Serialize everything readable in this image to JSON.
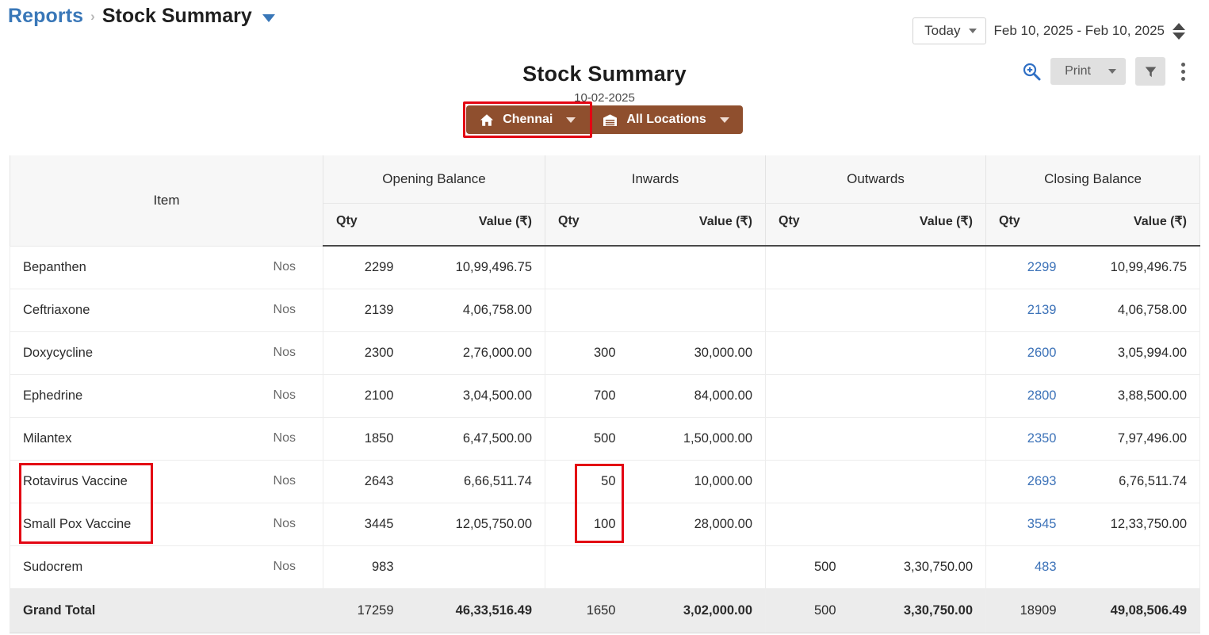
{
  "breadcrumb": {
    "root": "Reports",
    "separator": "›",
    "current": "Stock Summary"
  },
  "header": {
    "today_label": "Today",
    "date_range": "Feb 10, 2025 - Feb 10, 2025",
    "print_label": "Print"
  },
  "report": {
    "title": "Stock Summary",
    "date": "10-02-2025",
    "location_primary": "Chennai",
    "location_secondary": "All Locations",
    "accent_brown": "#8f4f2e",
    "link_blue": "#3c72b8",
    "annotation_red": "#e30613"
  },
  "table": {
    "item_header": "Item",
    "groups": [
      "Opening Balance",
      "Inwards",
      "Outwards",
      "Closing Balance"
    ],
    "sub_headers": [
      "Qty",
      "Value (₹)"
    ],
    "uom": "Nos",
    "rows": [
      {
        "item": "Bepanthen",
        "uom": "Nos",
        "ob_qty": "2299",
        "ob_val": "10,99,496.75",
        "in_qty": "",
        "in_val": "",
        "out_qty": "",
        "out_val": "",
        "cb_qty": "2299",
        "cb_val": "10,99,496.75"
      },
      {
        "item": "Ceftriaxone",
        "uom": "Nos",
        "ob_qty": "2139",
        "ob_val": "4,06,758.00",
        "in_qty": "",
        "in_val": "",
        "out_qty": "",
        "out_val": "",
        "cb_qty": "2139",
        "cb_val": "4,06,758.00"
      },
      {
        "item": "Doxycycline",
        "uom": "Nos",
        "ob_qty": "2300",
        "ob_val": "2,76,000.00",
        "in_qty": "300",
        "in_val": "30,000.00",
        "out_qty": "",
        "out_val": "",
        "cb_qty": "2600",
        "cb_val": "3,05,994.00"
      },
      {
        "item": "Ephedrine",
        "uom": "Nos",
        "ob_qty": "2100",
        "ob_val": "3,04,500.00",
        "in_qty": "700",
        "in_val": "84,000.00",
        "out_qty": "",
        "out_val": "",
        "cb_qty": "2800",
        "cb_val": "3,88,500.00"
      },
      {
        "item": "Milantex",
        "uom": "Nos",
        "ob_qty": "1850",
        "ob_val": "6,47,500.00",
        "in_qty": "500",
        "in_val": "1,50,000.00",
        "out_qty": "",
        "out_val": "",
        "cb_qty": "2350",
        "cb_val": "7,97,496.00"
      },
      {
        "item": "Rotavirus Vaccine",
        "uom": "Nos",
        "ob_qty": "2643",
        "ob_val": "6,66,511.74",
        "in_qty": "50",
        "in_val": "10,000.00",
        "out_qty": "",
        "out_val": "",
        "cb_qty": "2693",
        "cb_val": "6,76,511.74"
      },
      {
        "item": "Small Pox Vaccine",
        "uom": "Nos",
        "ob_qty": "3445",
        "ob_val": "12,05,750.00",
        "in_qty": "100",
        "in_val": "28,000.00",
        "out_qty": "",
        "out_val": "",
        "cb_qty": "3545",
        "cb_val": "12,33,750.00"
      },
      {
        "item": "Sudocrem",
        "uom": "Nos",
        "ob_qty": "983",
        "ob_val": "",
        "in_qty": "",
        "in_val": "",
        "out_qty": "500",
        "out_val": "3,30,750.00",
        "cb_qty": "483",
        "cb_val": ""
      }
    ],
    "grand_total": {
      "item": "Grand Total",
      "ob_qty": "17259",
      "ob_val": "46,33,516.49",
      "in_qty": "1650",
      "in_val": "3,02,000.00",
      "out_qty": "500",
      "out_val": "3,30,750.00",
      "cb_qty": "18909",
      "cb_val": "49,08,506.49"
    }
  }
}
